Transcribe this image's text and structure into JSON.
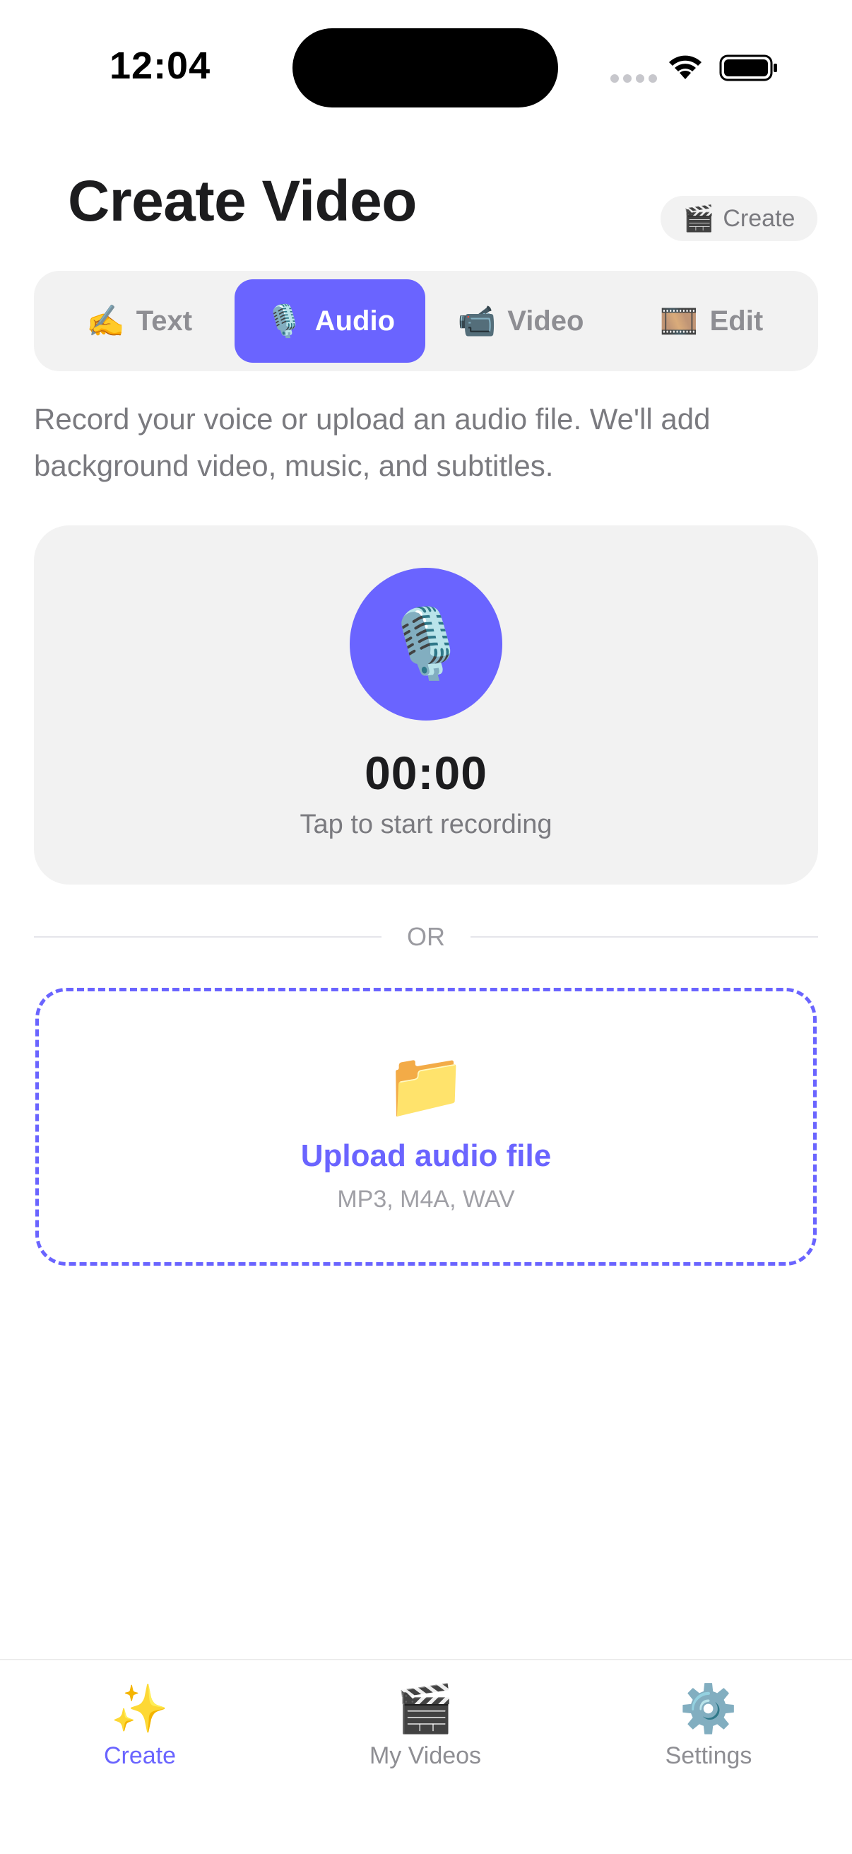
{
  "status_bar": {
    "time": "12:04"
  },
  "header": {
    "title": "Create Video",
    "chip": {
      "icon": "clapper-board-icon",
      "glyph": "🎬",
      "label": "Create"
    }
  },
  "tabs": [
    {
      "icon": "writing-hand-icon",
      "glyph": "✍️",
      "label": "Text",
      "active": false
    },
    {
      "icon": "microphone-icon",
      "glyph": "🎙️",
      "label": "Audio",
      "active": true
    },
    {
      "icon": "video-camera-icon",
      "glyph": "📹",
      "label": "Video",
      "active": false
    },
    {
      "icon": "film-frames-icon",
      "glyph": "🎞️",
      "label": "Edit",
      "active": false
    }
  ],
  "description": "Record your voice or upload an audio file. We'll add background video, music, and subtitles.",
  "recorder": {
    "icon": "studio-microphone-icon",
    "glyph": "🎙️",
    "timer": "00:00",
    "hint": "Tap to start recording"
  },
  "divider": {
    "label": "OR"
  },
  "upload": {
    "icon": "folder-icon",
    "glyph": "📁",
    "title": "Upload audio file",
    "formats": "MP3, M4A, WAV"
  },
  "tab_bar": {
    "items": [
      {
        "icon": "sparkles-icon",
        "glyph": "✨",
        "label": "Create",
        "active": true
      },
      {
        "icon": "clapper-board-icon",
        "glyph": "🎬",
        "label": "My Videos",
        "active": false
      },
      {
        "icon": "gear-icon",
        "glyph": "⚙️",
        "label": "Settings",
        "active": false
      }
    ]
  },
  "colors": {
    "accent": "#6a64ff",
    "card_background": "#f2f2f2",
    "muted_text": "#7a7a7f"
  }
}
